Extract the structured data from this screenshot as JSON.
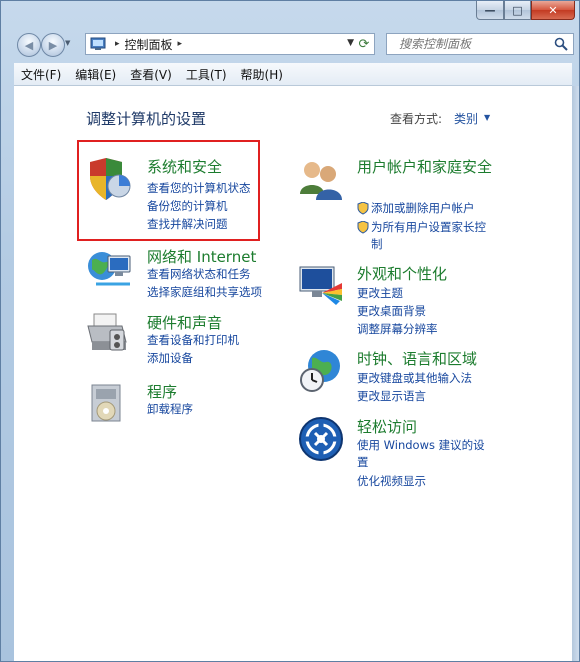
{
  "window": {
    "controls": {
      "minimize": "—",
      "maximize": "□",
      "close": "✕"
    }
  },
  "address": {
    "root_sep": "▸",
    "crumb": "控制面板",
    "crumb_sep": "▸",
    "search_placeholder": "搜索控制面板"
  },
  "menu": [
    "文件(F)",
    "编辑(E)",
    "查看(V)",
    "工具(T)",
    "帮助(H)"
  ],
  "page": {
    "title": "调整计算机的设置",
    "view_by_label": "查看方式:",
    "view_by_value": "类别"
  },
  "categories": [
    {
      "title": "系统和安全",
      "links": [
        "查看您的计算机状态",
        "备份您的计算机",
        "查找并解决问题"
      ]
    },
    {
      "title": "网络和 Internet",
      "links": [
        "查看网络状态和任务",
        "选择家庭组和共享选项"
      ]
    },
    {
      "title": "硬件和声音",
      "links": [
        "查看设备和打印机",
        "添加设备"
      ]
    },
    {
      "title": "程序",
      "links": [
        "卸载程序"
      ]
    },
    {
      "title": "用户帐户和家庭安全",
      "links": [
        "添加或删除用户帐户",
        "为所有用户设置家长控制"
      ]
    },
    {
      "title": "外观和个性化",
      "links": [
        "更改主题",
        "更改桌面背景",
        "调整屏幕分辨率"
      ]
    },
    {
      "title": "时钟、语言和区域",
      "links": [
        "更改键盘或其他输入法",
        "更改显示语言"
      ]
    },
    {
      "title": "轻松访问",
      "links": [
        "使用 Windows 建议的设置",
        "优化视频显示"
      ]
    }
  ]
}
